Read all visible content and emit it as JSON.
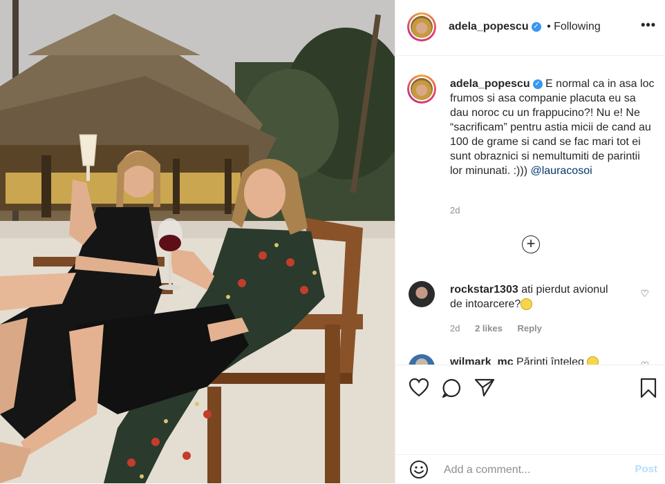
{
  "post": {
    "image_alt": "Two women with drinks sitting on wooden chairs on a beach at dusk"
  },
  "header": {
    "username": "adela_popescu",
    "separator": "•",
    "following_label": "Following",
    "more_label": "•••"
  },
  "caption": {
    "username": "adela_popescu",
    "text": " E normal ca in asa loc frumos si asa companie placuta eu sa dau noroc cu un frappucino?! Nu e! Ne “sacrificam” pentru astia micii de cand au 100 de grame si cand se fac mari tot ei sunt obraznici si nemultumiti de parintii lor minunati. :))) ",
    "mention": "@lauracosoi",
    "time": "2d"
  },
  "load_more_label": "+",
  "comments": [
    {
      "username": "rockstar1303",
      "text": " ati pierdut avionul de intoarcere?",
      "time": "2d",
      "likes": "2 likes",
      "reply": "Reply"
    },
    {
      "username": "wilmark_mc",
      "text": " Părinți înțeleg"
    }
  ],
  "comment_box": {
    "placeholder": "Add a comment...",
    "post_label": "Post"
  },
  "colors": {
    "verified": "#3897f0",
    "mention": "#00376b",
    "post_disabled": "#b2dffc",
    "muted": "#8e8e8e"
  }
}
